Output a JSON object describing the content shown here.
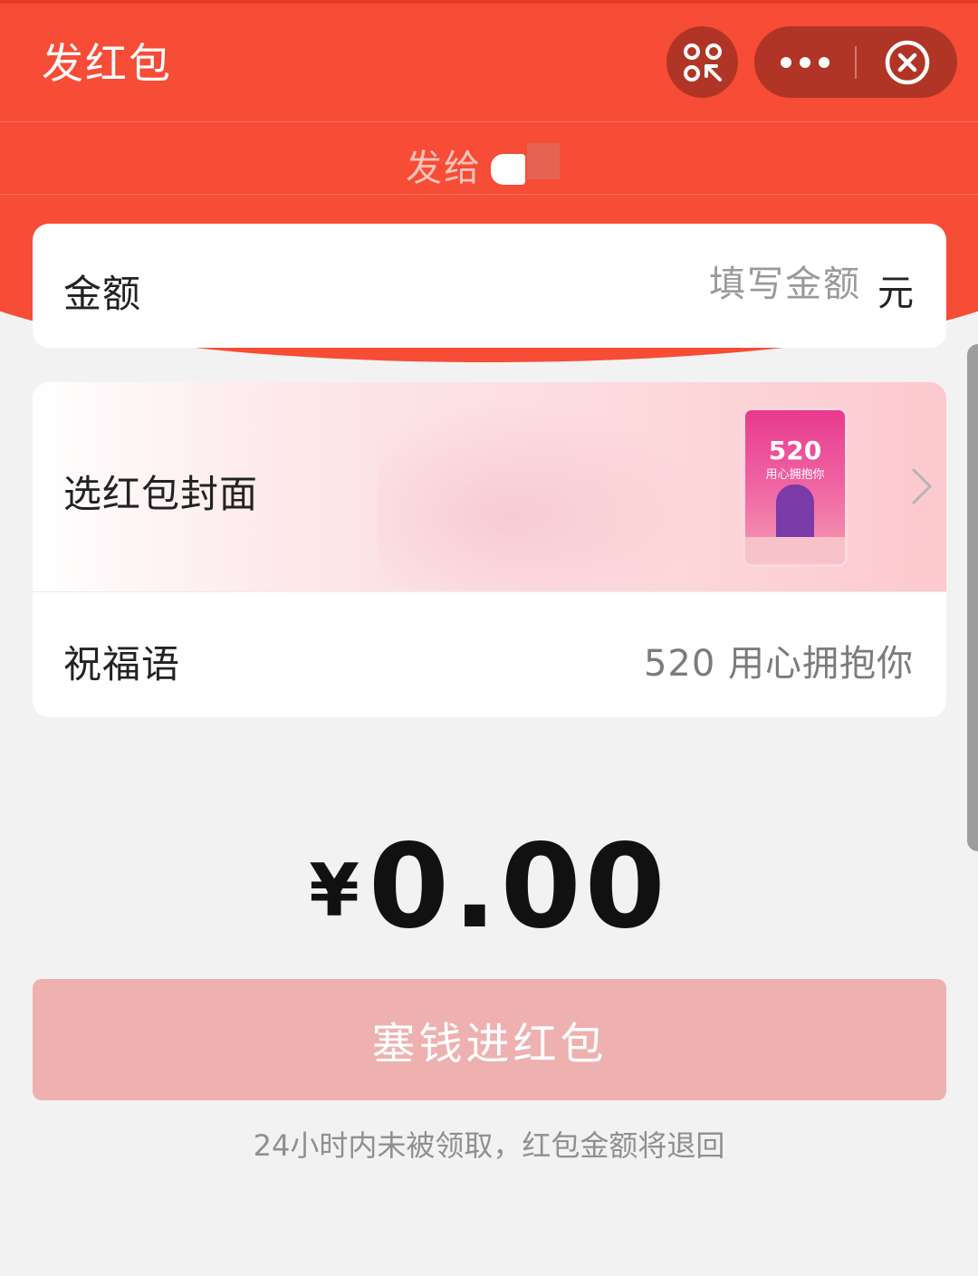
{
  "nav": {
    "title": "发红包"
  },
  "header": {
    "send_to_label": "发给"
  },
  "amount": {
    "label": "金额",
    "placeholder": "填写金额",
    "unit": "元"
  },
  "cover": {
    "label": "选红包封面",
    "thumb_title": "520",
    "thumb_subtitle": "用心拥抱你"
  },
  "blessing": {
    "label": "祝福语",
    "value": "520 用心拥抱你"
  },
  "total": {
    "currency": "¥",
    "value": "0.00"
  },
  "submit": {
    "label": "塞钱进红包"
  },
  "footnote": "24小时内未被领取，红包金额将退回",
  "colors": {
    "header_red": "#f74c36",
    "capsule": "#b13526",
    "button_disabled": "#eeb1b0"
  },
  "icons": {
    "scan": "scan-icon",
    "more": "more-icon",
    "close": "close-icon",
    "chevron": "chevron-right-icon"
  }
}
